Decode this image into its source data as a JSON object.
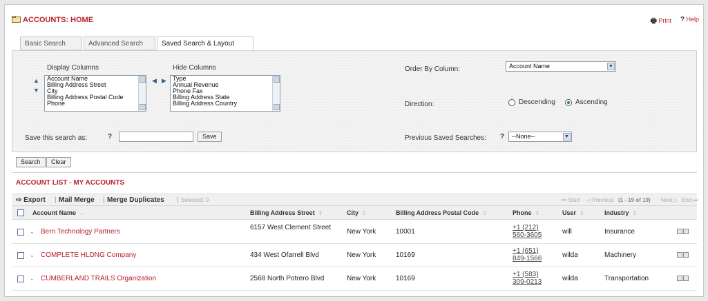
{
  "header": {
    "title": "ACCOUNTS: HOME",
    "print": "Print",
    "help": "Help"
  },
  "tabs": [
    {
      "label": "Basic Search"
    },
    {
      "label": "Advanced Search"
    },
    {
      "label": "Saved Search & Layout"
    }
  ],
  "layout": {
    "display_columns_label": "Display Columns",
    "hide_columns_label": "Hide Columns",
    "display_columns": [
      "Account Name",
      "Billing Address Street",
      "City",
      "Billing Address Postal Code",
      "Phone"
    ],
    "hide_columns": [
      "Type",
      "Annual Revenue",
      "Phone Fax",
      "Billing Address State",
      "Billing Address Country"
    ],
    "order_by_label": "Order By Column:",
    "order_by_value": "Account Name",
    "direction_label": "Direction:",
    "descending": "Descending",
    "ascending": "Ascending",
    "save_as_label": "Save this search as:",
    "save_button": "Save",
    "previous_saved_label": "Previous Saved Searches:",
    "previous_saved_value": "--None--",
    "help_mark": "?"
  },
  "actions": {
    "search": "Search",
    "clear": "Clear"
  },
  "list": {
    "title": "ACCOUNT LIST - MY ACCOUNTS",
    "toolbar": {
      "export": "Export",
      "mail_merge": "Mail Merge",
      "merge_duplicates": "Merge Duplicates",
      "selected": "Selected: 0"
    },
    "pager": {
      "start": "Start",
      "previous": "Previous",
      "range": "(1 - 19 of 19)",
      "next": "Next",
      "end": "End"
    },
    "columns": [
      "Account Name",
      "Billing Address Street",
      "City",
      "Billing Address Postal Code",
      "Phone",
      "User",
      "Industry"
    ],
    "rows": [
      {
        "name": "Bern Technology Partners",
        "street": "6157 West Clement Street",
        "city": "New York",
        "postal": "10001",
        "phone": "+1 (212) 560-3605",
        "user": "will",
        "industry": "Insurance"
      },
      {
        "name": "COMPLETE HLDNG Company",
        "street": "434 West Ofarrell Blvd",
        "city": "New York",
        "postal": "10169",
        "phone": "+1 (651) 849-1566",
        "user": "wilda",
        "industry": "Machinery"
      },
      {
        "name": "CUMBERLAND TRAILS Organization",
        "street": "2568 North Potrero Blvd",
        "city": "New York",
        "postal": "10169",
        "phone": "+1 (583) 309-0213",
        "user": "wilda",
        "industry": "Transportation"
      }
    ]
  }
}
